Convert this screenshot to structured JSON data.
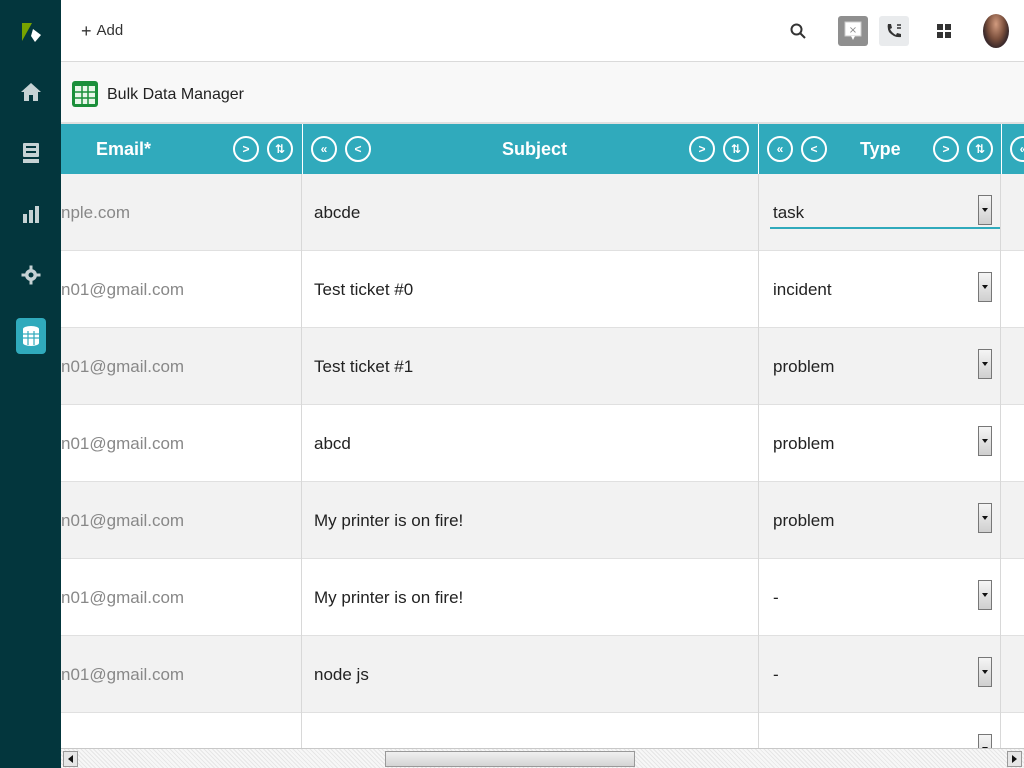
{
  "nav": {
    "items": [
      {
        "name": "logo",
        "icon": "zendesk-logo-icon"
      },
      {
        "name": "home",
        "icon": "home-icon"
      },
      {
        "name": "views",
        "icon": "views-icon"
      },
      {
        "name": "reports",
        "icon": "bar-chart-icon"
      },
      {
        "name": "admin",
        "icon": "gear-icon"
      },
      {
        "name": "bulk-data-manager",
        "icon": "database-icon"
      }
    ],
    "bg_color": "#03363d",
    "accent": "#30aabc"
  },
  "topbar": {
    "add_icon": "+",
    "add_label": "Add",
    "chat_glyph": "×"
  },
  "app": {
    "title": "Bulk Data Manager"
  },
  "grid": {
    "columns": {
      "email": "Email*",
      "subject": "Subject",
      "type": "Type"
    },
    "buttons": {
      "next": ">",
      "first": "«",
      "prev": "<",
      "sort": "⇅"
    },
    "rows": [
      {
        "email": "nple.com",
        "subject": "abcde",
        "type": "task"
      },
      {
        "email": "n01@gmail.com",
        "subject": "Test ticket #0",
        "type": "incident"
      },
      {
        "email": "n01@gmail.com",
        "subject": "Test ticket #1",
        "type": "problem"
      },
      {
        "email": "n01@gmail.com",
        "subject": "abcd",
        "type": "problem"
      },
      {
        "email": "n01@gmail.com",
        "subject": "My printer is on fire!",
        "type": "problem"
      },
      {
        "email": "n01@gmail.com",
        "subject": "My printer is on fire!",
        "type": "-"
      },
      {
        "email": "n01@gmail.com",
        "subject": "node js",
        "type": "-"
      }
    ]
  }
}
